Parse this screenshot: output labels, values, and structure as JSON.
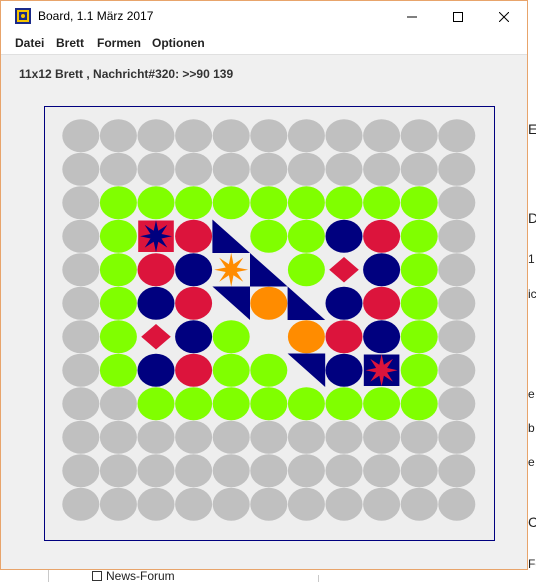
{
  "window": {
    "title": "Board, 1.1 März 2017"
  },
  "menu": [
    "Datei",
    "Brett",
    "Formen",
    "Optionen"
  ],
  "status": "11x12 Brett , Nachricht#320: >>90 139",
  "background": {
    "forum_label": "News-Forum",
    "edge_letters": [
      "E",
      "D",
      "1",
      "ic",
      "e",
      "b",
      "e",
      "C",
      "Fo"
    ]
  },
  "colors": {
    "grey": "#c0c0c0",
    "green": "#80ff00",
    "navy": "#00007f",
    "red": "#dc143c",
    "orange": "#ff8c00",
    "board_bg": "#eeeeee",
    "board_border": "#00007f"
  },
  "board": {
    "columns": 11,
    "rows": 12,
    "cells": [
      [
        "G",
        "G",
        "G",
        "G",
        "G",
        "G",
        "G",
        "G",
        "G",
        "G",
        "G"
      ],
      [
        "G",
        "G",
        "G",
        "G",
        "G",
        "G",
        "G",
        "G",
        "G",
        "G",
        "G"
      ],
      [
        "G",
        "L",
        "L",
        "L",
        "L",
        "L",
        "L",
        "L",
        "L",
        "L",
        "G"
      ],
      [
        "G",
        "L",
        "SQ-STAR-RED",
        "R",
        "TRI-UL",
        "L",
        "L",
        "N",
        "R",
        "L",
        "G"
      ],
      [
        "G",
        "L",
        "R",
        "N",
        "STAR-ORANGE",
        "TRI-LL",
        "L",
        "DIAMOND",
        "N",
        "L",
        "G"
      ],
      [
        "G",
        "L",
        "N",
        "R",
        "TRI-UR",
        "O",
        "TRI-LL",
        "N",
        "R",
        "L",
        "G"
      ],
      [
        "G",
        "L",
        "DIAMOND",
        "N",
        "L",
        "E",
        "O",
        "R",
        "N",
        "L",
        "G"
      ],
      [
        "G",
        "L",
        "N",
        "R",
        "L",
        "L",
        "TRI-UR",
        "N",
        "SQ-STAR-NAVY",
        "L",
        "G"
      ],
      [
        "G",
        "G",
        "L",
        "L",
        "L",
        "L",
        "L",
        "L",
        "L",
        "L",
        "G"
      ],
      [
        "G",
        "G",
        "G",
        "G",
        "G",
        "G",
        "G",
        "G",
        "G",
        "G",
        "G"
      ],
      [
        "G",
        "G",
        "G",
        "G",
        "G",
        "G",
        "G",
        "G",
        "G",
        "G",
        "G"
      ],
      [
        "G",
        "G",
        "G",
        "G",
        "G",
        "G",
        "G",
        "G",
        "G",
        "G",
        "G"
      ]
    ]
  }
}
